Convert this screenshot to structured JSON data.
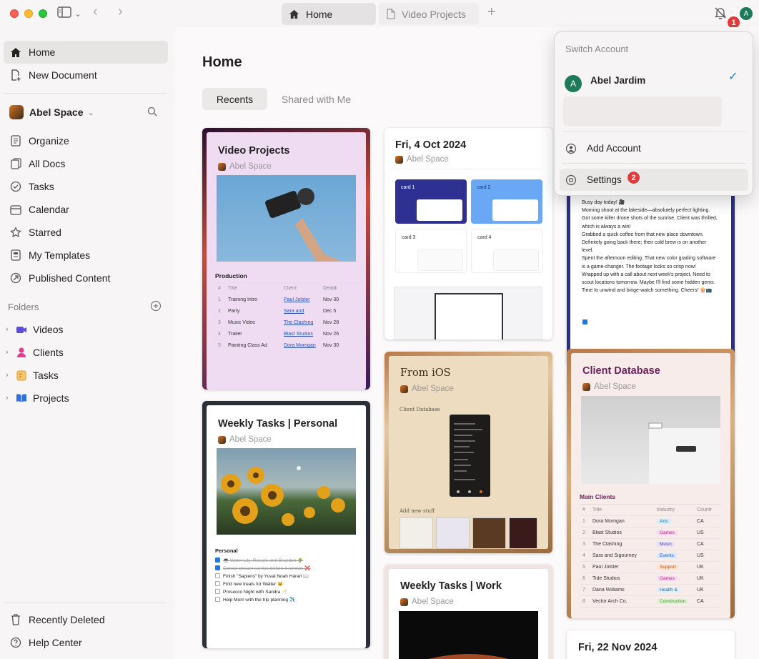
{
  "tabs": [
    {
      "label": "Home"
    },
    {
      "label": "Video Projects"
    }
  ],
  "user_initial": "A",
  "badges": {
    "one": "1",
    "two": "2"
  },
  "sidebar": {
    "home": "Home",
    "new_document": "New Document",
    "space_name": "Abel Space",
    "nav": [
      "Organize",
      "All Docs",
      "Tasks",
      "Calendar",
      "Starred",
      "My Templates",
      "Published Content"
    ],
    "folders_label": "Folders",
    "folders": [
      {
        "label": "Videos",
        "color": "#5b4de0"
      },
      {
        "label": "Clients",
        "color": "#e43a8f"
      },
      {
        "label": "Tasks",
        "color": "#f0a236"
      },
      {
        "label": "Projects",
        "color": "#2f6fe0"
      }
    ],
    "recently_deleted": "Recently Deleted",
    "help_center": "Help Center"
  },
  "main": {
    "title": "Home",
    "seg_recents": "Recents",
    "seg_shared": "Shared with Me"
  },
  "cards": {
    "space": "Abel Space",
    "video": {
      "title": "Video Projects",
      "section": "Production",
      "headers": [
        "#",
        "Title",
        "Client",
        "Deadli"
      ],
      "rows": [
        [
          "1",
          "Training Intro",
          "Paul Jolster",
          "Nov 30"
        ],
        [
          "2",
          "Party",
          "Sara and",
          "Dec 5"
        ],
        [
          "3",
          "Music Video",
          "The Clashing",
          "Nov 28"
        ],
        [
          "4",
          "Trailer",
          "Blast Studios",
          "Nov 26"
        ],
        [
          "5",
          "Painting Class Ad",
          "Dora Morrigan",
          "Nov 30"
        ]
      ]
    },
    "oct": {
      "title": "Fri, 4 Oct 2024",
      "cards": [
        "card 1",
        "card 2",
        "card 3",
        "card 4"
      ]
    },
    "journal": {
      "lines": [
        "Busy day today! 🎥",
        "Morning shoot at the lakeside—absolutely perfect lighting.",
        "Got some killer drone shots of the sunrise. Client was thrilled,",
        "which is always a win!",
        "Grabbed a quick coffee from that new place downtown.",
        "Definitely going back there; their cold brew is on another",
        "level.",
        "Spent the afternoon editing. That new color grading software",
        "is a game-changer. The footage looks so crisp now!",
        "Wrapped up with a call about next week's project. Need to",
        "scout locations tomorrow. Maybe I'll find some hidden gems.",
        "Time to unwind and binge-watch something. Cheers! 🍿📺"
      ]
    },
    "ios": {
      "title": "From iOS",
      "section1": "Client Database",
      "section2": "Add new stuff"
    },
    "client": {
      "title": "Client Database",
      "section": "Main Clients",
      "headers": [
        "#",
        "Title",
        "Industry",
        "Countr"
      ],
      "rows": [
        [
          "1",
          "Dora Morrigan",
          "Arts",
          "CA"
        ],
        [
          "2",
          "Blast Studios",
          "Games",
          "US"
        ],
        [
          "3",
          "The Clashing",
          "Music",
          "CA"
        ],
        [
          "4",
          "Sara and Sigourney",
          "Events",
          "US"
        ],
        [
          "5",
          "Paul Jolster",
          "Support",
          "UK"
        ],
        [
          "6",
          "Tide Studios",
          "Games",
          "UK"
        ],
        [
          "7",
          "Dana Williams",
          "Health &",
          "UK"
        ],
        [
          "8",
          "Vector Arch Co.",
          "Construction",
          "CA"
        ]
      ]
    },
    "personal": {
      "title": "Weekly Tasks | Personal",
      "section": "Personal",
      "tasks": [
        {
          "text": "💻 Water Lily, Rosalie and Brandon 🌵",
          "done": true
        },
        {
          "text": "Cancel stream service before it renews ❌",
          "done": true
        },
        {
          "text": "Finish \"Sapiens\" by Yuval Noah Harari 📖",
          "done": false
        },
        {
          "text": "Find new treats for Walter 🐱",
          "done": false
        },
        {
          "text": "Prosecco Night with Sandra 🥂",
          "done": false
        },
        {
          "text": "Help Mom with the trip planning ✈️",
          "done": false
        }
      ]
    },
    "work": {
      "title": "Weekly Tasks | Work"
    },
    "nov": {
      "title": "Fri, 22 Nov 2024"
    }
  },
  "dropdown": {
    "header": "Switch Account",
    "account": "Abel Jardim",
    "add_account": "Add Account",
    "settings": "Settings"
  }
}
